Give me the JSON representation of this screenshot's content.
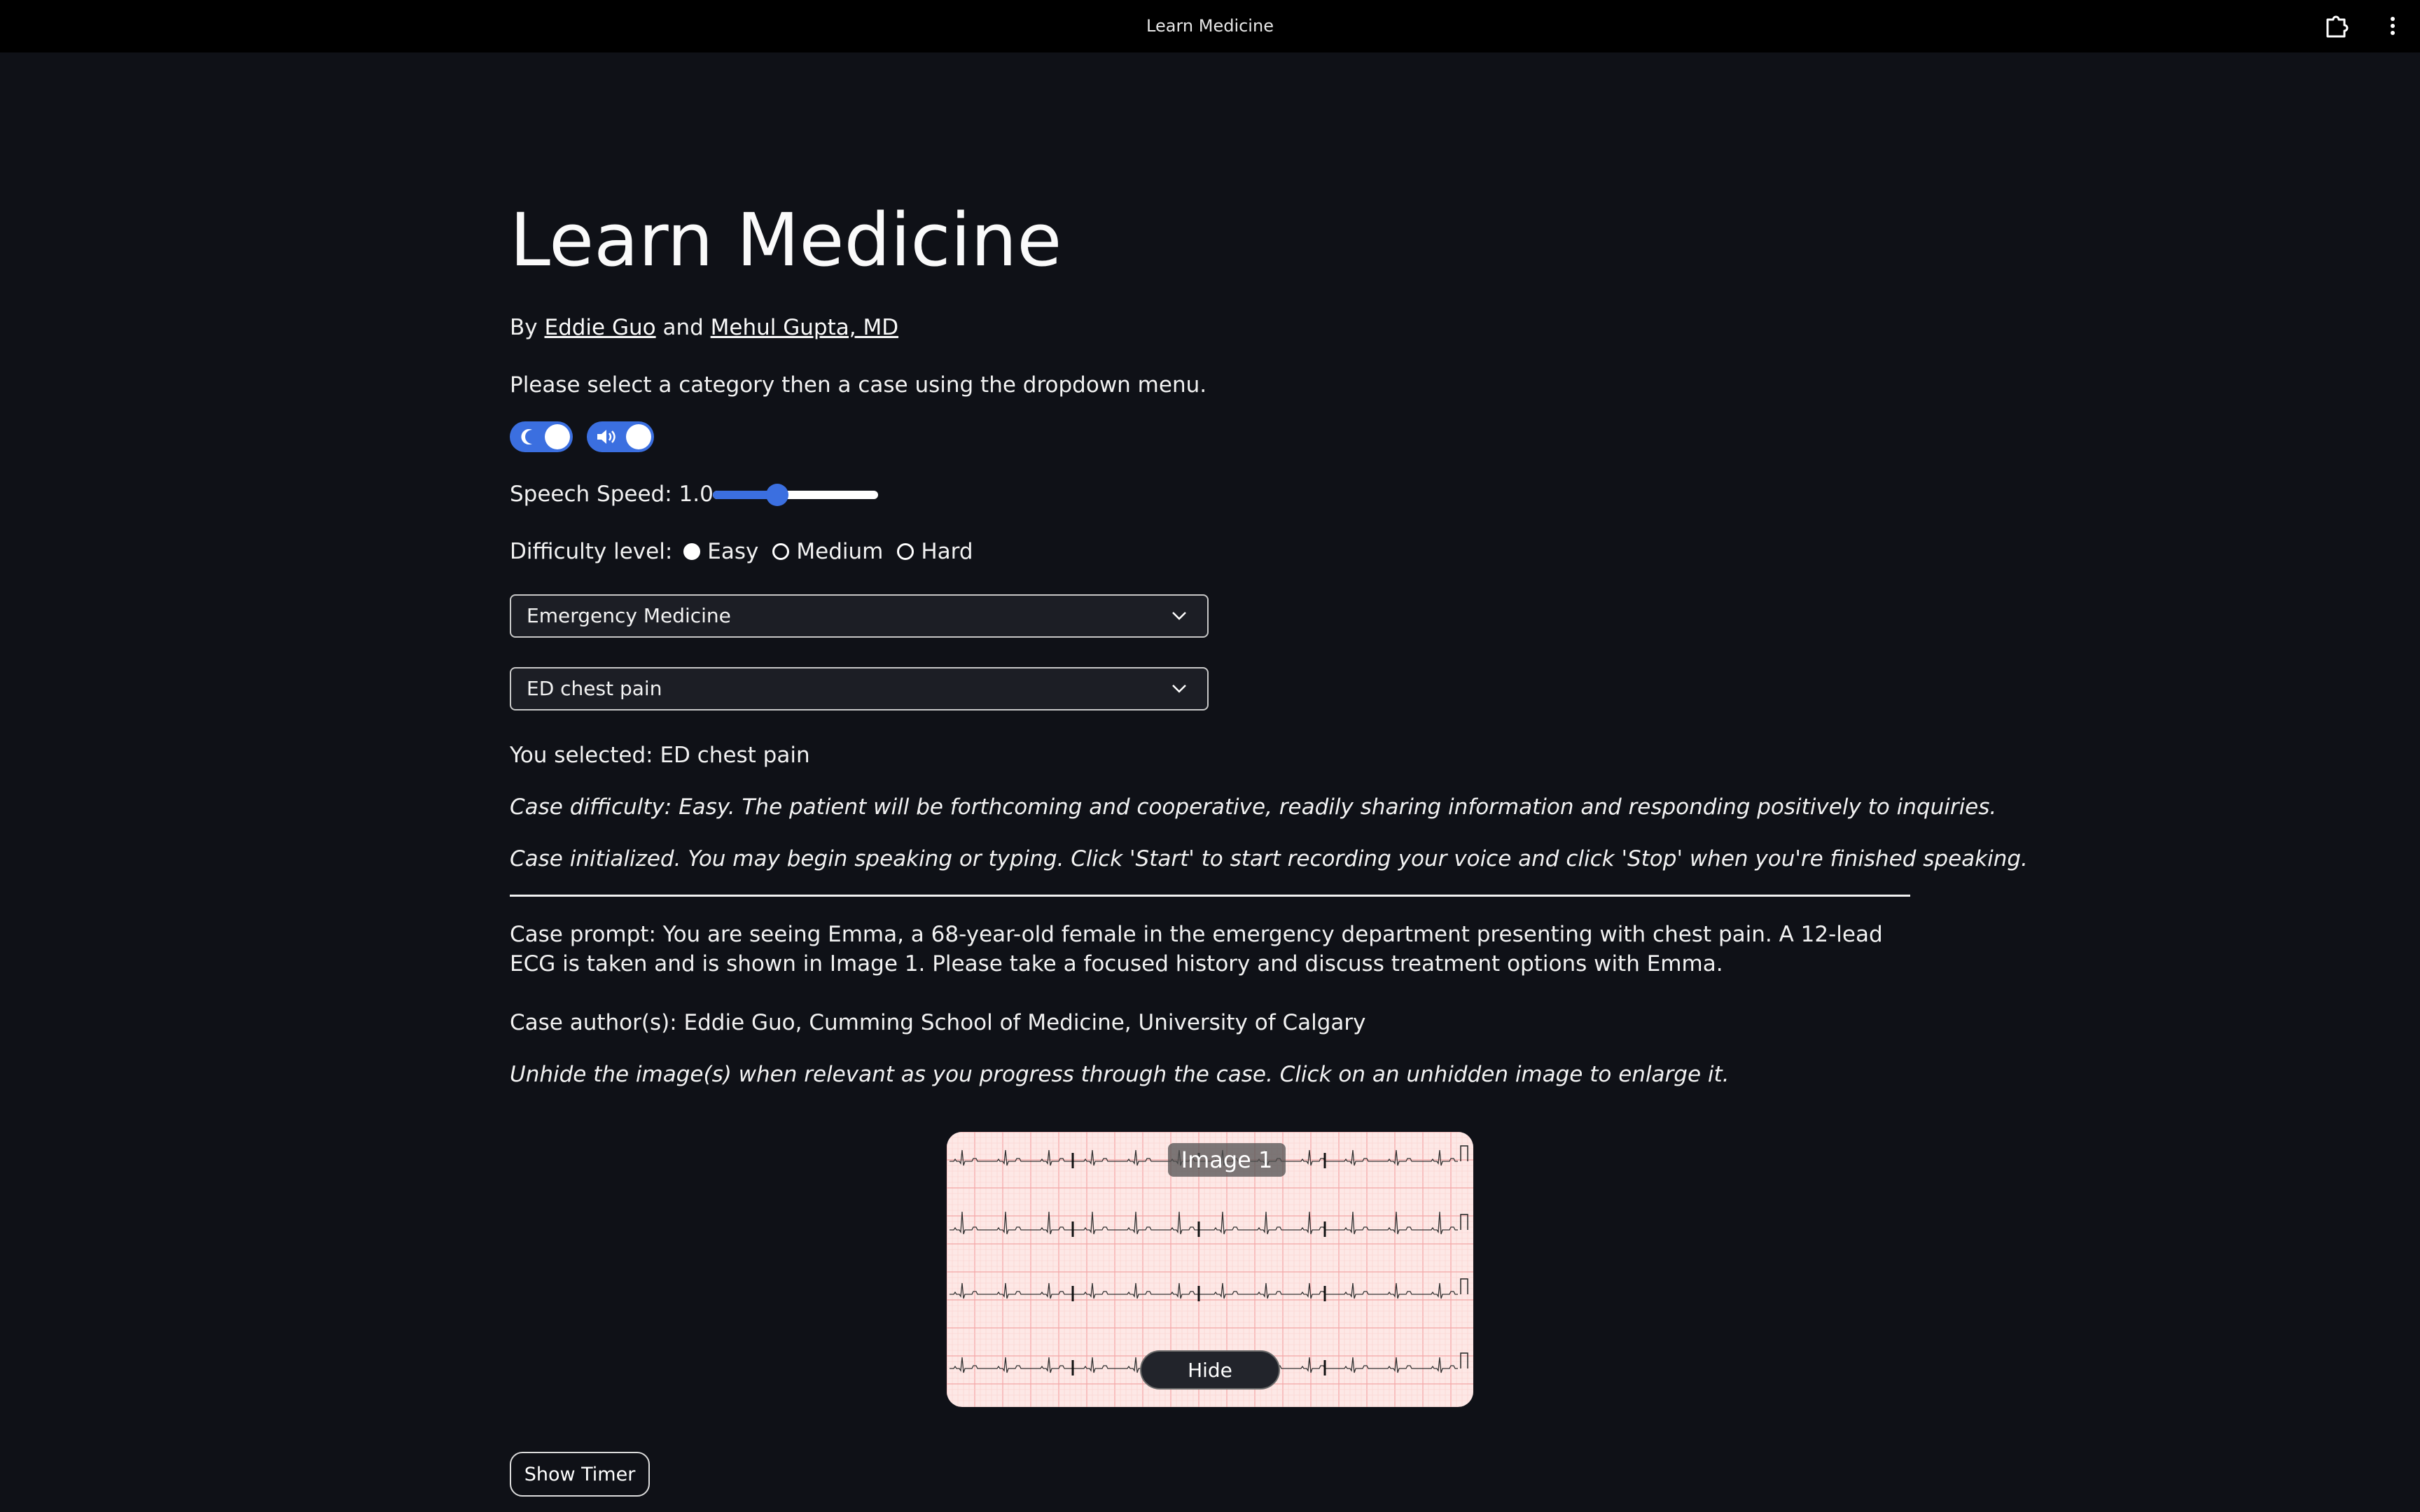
{
  "window": {
    "title": "Learn Medicine"
  },
  "header": {
    "title": "Learn Medicine",
    "by_prefix": "By",
    "author1": "Eddie Guo",
    "and_word": "and",
    "author2": "Mehul Gupta, MD",
    "instructions": "Please select a category then a case using the dropdown menu."
  },
  "toggles": {
    "dark_mode_on": true,
    "sound_on": true
  },
  "speech": {
    "label": "Speech Speed: 1.0",
    "value_fraction": 0.39
  },
  "difficulty": {
    "label": "Difficulty level:",
    "options": [
      "Easy",
      "Medium",
      "Hard"
    ],
    "selected": "Easy"
  },
  "category_select": {
    "value": "Emergency Medicine"
  },
  "case_select": {
    "value": "ED chest pain"
  },
  "status": {
    "selected": "You selected: ED chest pain",
    "difficulty_desc": "Case difficulty: Easy. The patient will be forthcoming and cooperative, readily sharing information and responding positively to inquiries.",
    "initialized": "Case initialized. You may begin speaking or typing. Click 'Start' to start recording your voice and click 'Stop' when you're finished speaking."
  },
  "case": {
    "prompt": "Case prompt: You are seeing Emma, a 68-year-old female in the emergency department presenting with chest pain. A 12-lead ECG is taken and is shown in Image 1. Please take a focused history and discuss treatment options with Emma.",
    "authors": "Case author(s): Eddie Guo, Cumming School of Medicine, University of Calgary",
    "image_hint": "Unhide the image(s) when relevant as you progress through the case. Click on an unhidden image to enlarge it."
  },
  "image": {
    "label": "Image 1",
    "hide_button": "Hide"
  },
  "timer": {
    "button": "Show Timer"
  },
  "colors": {
    "background": "#0f1117",
    "accent": "#3b6fe0",
    "ecg_paper": "#fde8e6"
  },
  "icons": {
    "topbar_ext": "extension-icon",
    "topbar_menu": "kebab-menu-icon",
    "dark_toggle": "moon-icon",
    "sound_toggle": "speaker-icon",
    "select_chevron": "chevron-down-icon"
  }
}
